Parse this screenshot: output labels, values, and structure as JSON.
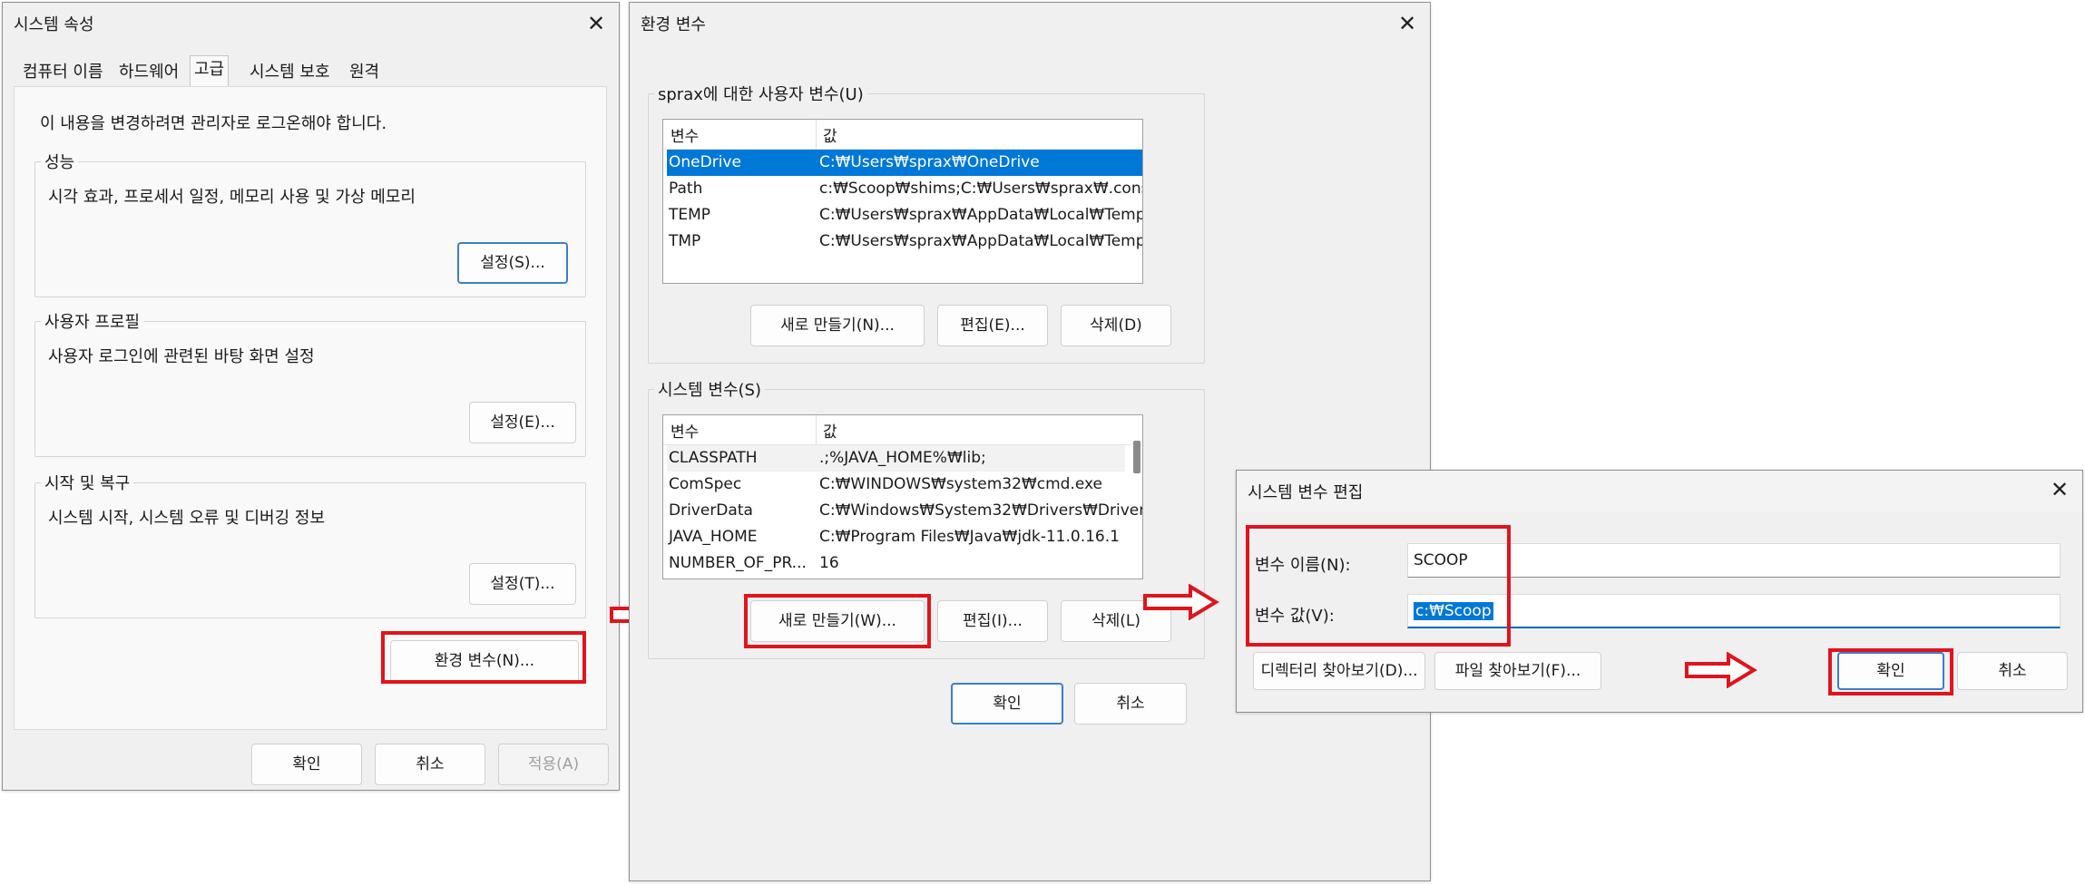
{
  "sys_props": {
    "title": "시스템 속성",
    "tabs": [
      "컴퓨터 이름",
      "하드웨어",
      "고급",
      "시스템 보호",
      "원격"
    ],
    "admin_notice": "이 내용을 변경하려면 관리자로 로그온해야 합니다.",
    "groups": {
      "performance": {
        "label": "성능",
        "desc": "시각 효과, 프로세서 일정, 메모리 사용 및 가상 메모리",
        "button": "설정(S)..."
      },
      "profile": {
        "label": "사용자 프로필",
        "desc": "사용자 로그인에 관련된 바탕 화면 설정",
        "button": "설정(E)..."
      },
      "startup": {
        "label": "시작 및 복구",
        "desc": "시스템 시작, 시스템 오류 및 디버깅 정보",
        "button": "설정(T)..."
      }
    },
    "env_button": "환경 변수(N)...",
    "ok": "확인",
    "cancel": "취소",
    "apply": "적용(A)"
  },
  "env_vars": {
    "title": "환경 변수",
    "user_group_label": "sprax에 대한 사용자 변수(U)",
    "col_var": "변수",
    "col_val": "값",
    "user_vars": [
      {
        "name": "OneDrive",
        "value": "C:₩Users₩sprax₩OneDrive"
      },
      {
        "name": "Path",
        "value": "c:₩Scoop₩shims;C:₩Users₩sprax₩.conso..."
      },
      {
        "name": "TEMP",
        "value": "C:₩Users₩sprax₩AppData₩Local₩Temp"
      },
      {
        "name": "TMP",
        "value": "C:₩Users₩sprax₩AppData₩Local₩Temp"
      }
    ],
    "user_buttons": {
      "new": "새로 만들기(N)...",
      "edit": "편집(E)...",
      "delete": "삭제(D)"
    },
    "system_group_label": "시스템 변수(S)",
    "system_vars": [
      {
        "name": "CLASSPATH",
        "value": ".;%JAVA_HOME%₩lib;"
      },
      {
        "name": "ComSpec",
        "value": "C:₩WINDOWS₩system32₩cmd.exe"
      },
      {
        "name": "DriverData",
        "value": "C:₩Windows₩System32₩Drivers₩Driver..."
      },
      {
        "name": "JAVA_HOME",
        "value": "C:₩Program Files₩Java₩jdk-11.0.16.1"
      },
      {
        "name": "NUMBER_OF_PR...",
        "value": "16"
      }
    ],
    "system_buttons": {
      "new": "새로 만들기(W)...",
      "edit": "편집(I)...",
      "delete": "삭제(L)"
    },
    "ok": "확인",
    "cancel": "취소"
  },
  "edit_var": {
    "title": "시스템 변수 편집",
    "name_label": "변수 이름(N):",
    "name_value": "SCOOP",
    "value_label": "변수 값(V):",
    "value_value": "c:₩Scoop",
    "browse_dir": "디렉터리 찾아보기(D)...",
    "browse_file": "파일 찾아보기(F)...",
    "ok": "확인",
    "cancel": "취소"
  },
  "colors": {
    "highlight": "#e0141e",
    "selection": "#0078d7",
    "focus": "#3c7ec8"
  }
}
